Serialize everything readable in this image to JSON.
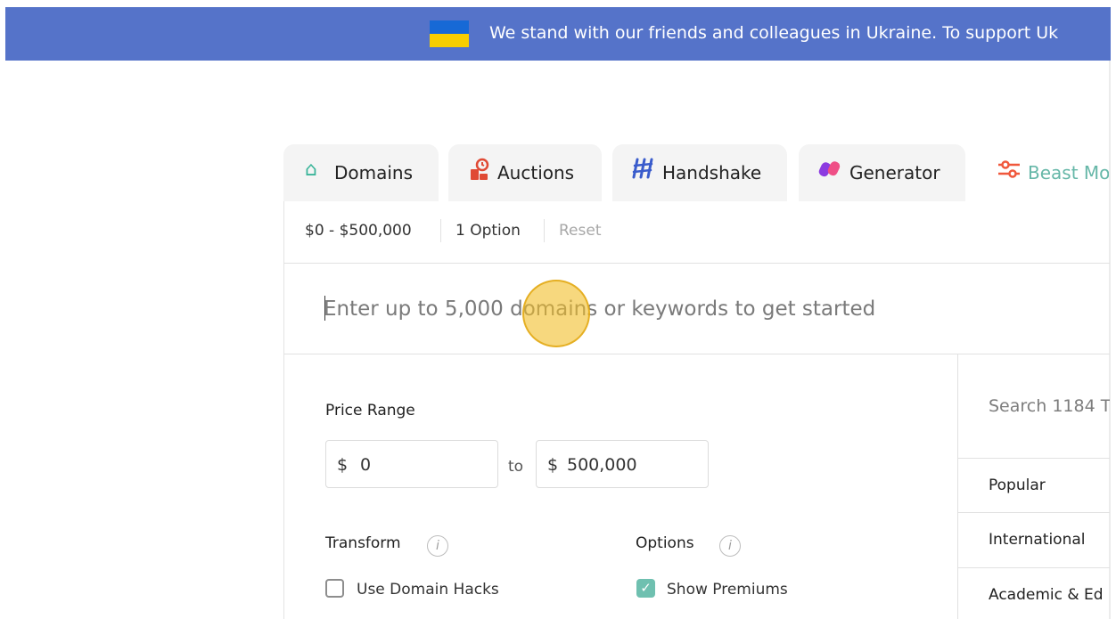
{
  "banner": {
    "flag_icon": "ukraine-flag-icon",
    "colors": {
      "background": "#5573c9",
      "flag_blue": "#1769d6",
      "flag_yellow": "#f7ce00"
    },
    "text": "We stand with our friends and colleagues in Ukraine. To support Uk"
  },
  "tabs": [
    {
      "label": "Domains",
      "icon": "home-icon",
      "icon_color": "#3bb59a"
    },
    {
      "label": "Auctions",
      "icon": "auction-gavel-icon",
      "icon_color": "#e04a35"
    },
    {
      "label": "Handshake",
      "icon": "handshake-logo-icon",
      "icon_color": "#3a5ccc"
    },
    {
      "label": "Generator",
      "icon": "generator-blocks-icon",
      "icon_color": "#8c3be0"
    },
    {
      "label": "Beast Mo",
      "icon": "sliders-icon",
      "icon_color": "#f0583c",
      "active": true
    }
  ],
  "filters": {
    "price": "$0 - $500,000",
    "options": "1 Option",
    "reset": "Reset"
  },
  "search": {
    "placeholder": "Enter up to 5,000 domains or keywords to get started",
    "value": ""
  },
  "price_range": {
    "title": "Price Range",
    "currency": "$",
    "min": "0",
    "to": "to",
    "max": "500,000"
  },
  "transform": {
    "title": "Transform",
    "use_domain_hacks": "Use Domain Hacks",
    "use_domain_hacks_checked": false
  },
  "options": {
    "title": "Options",
    "show_premiums": "Show Premiums",
    "show_premiums_checked": true
  },
  "tlds": {
    "search_placeholder": "Search 1184 T",
    "categories": [
      "Popular",
      "International",
      "Academic & Ed"
    ]
  },
  "accent_color": "#6fc0b0"
}
